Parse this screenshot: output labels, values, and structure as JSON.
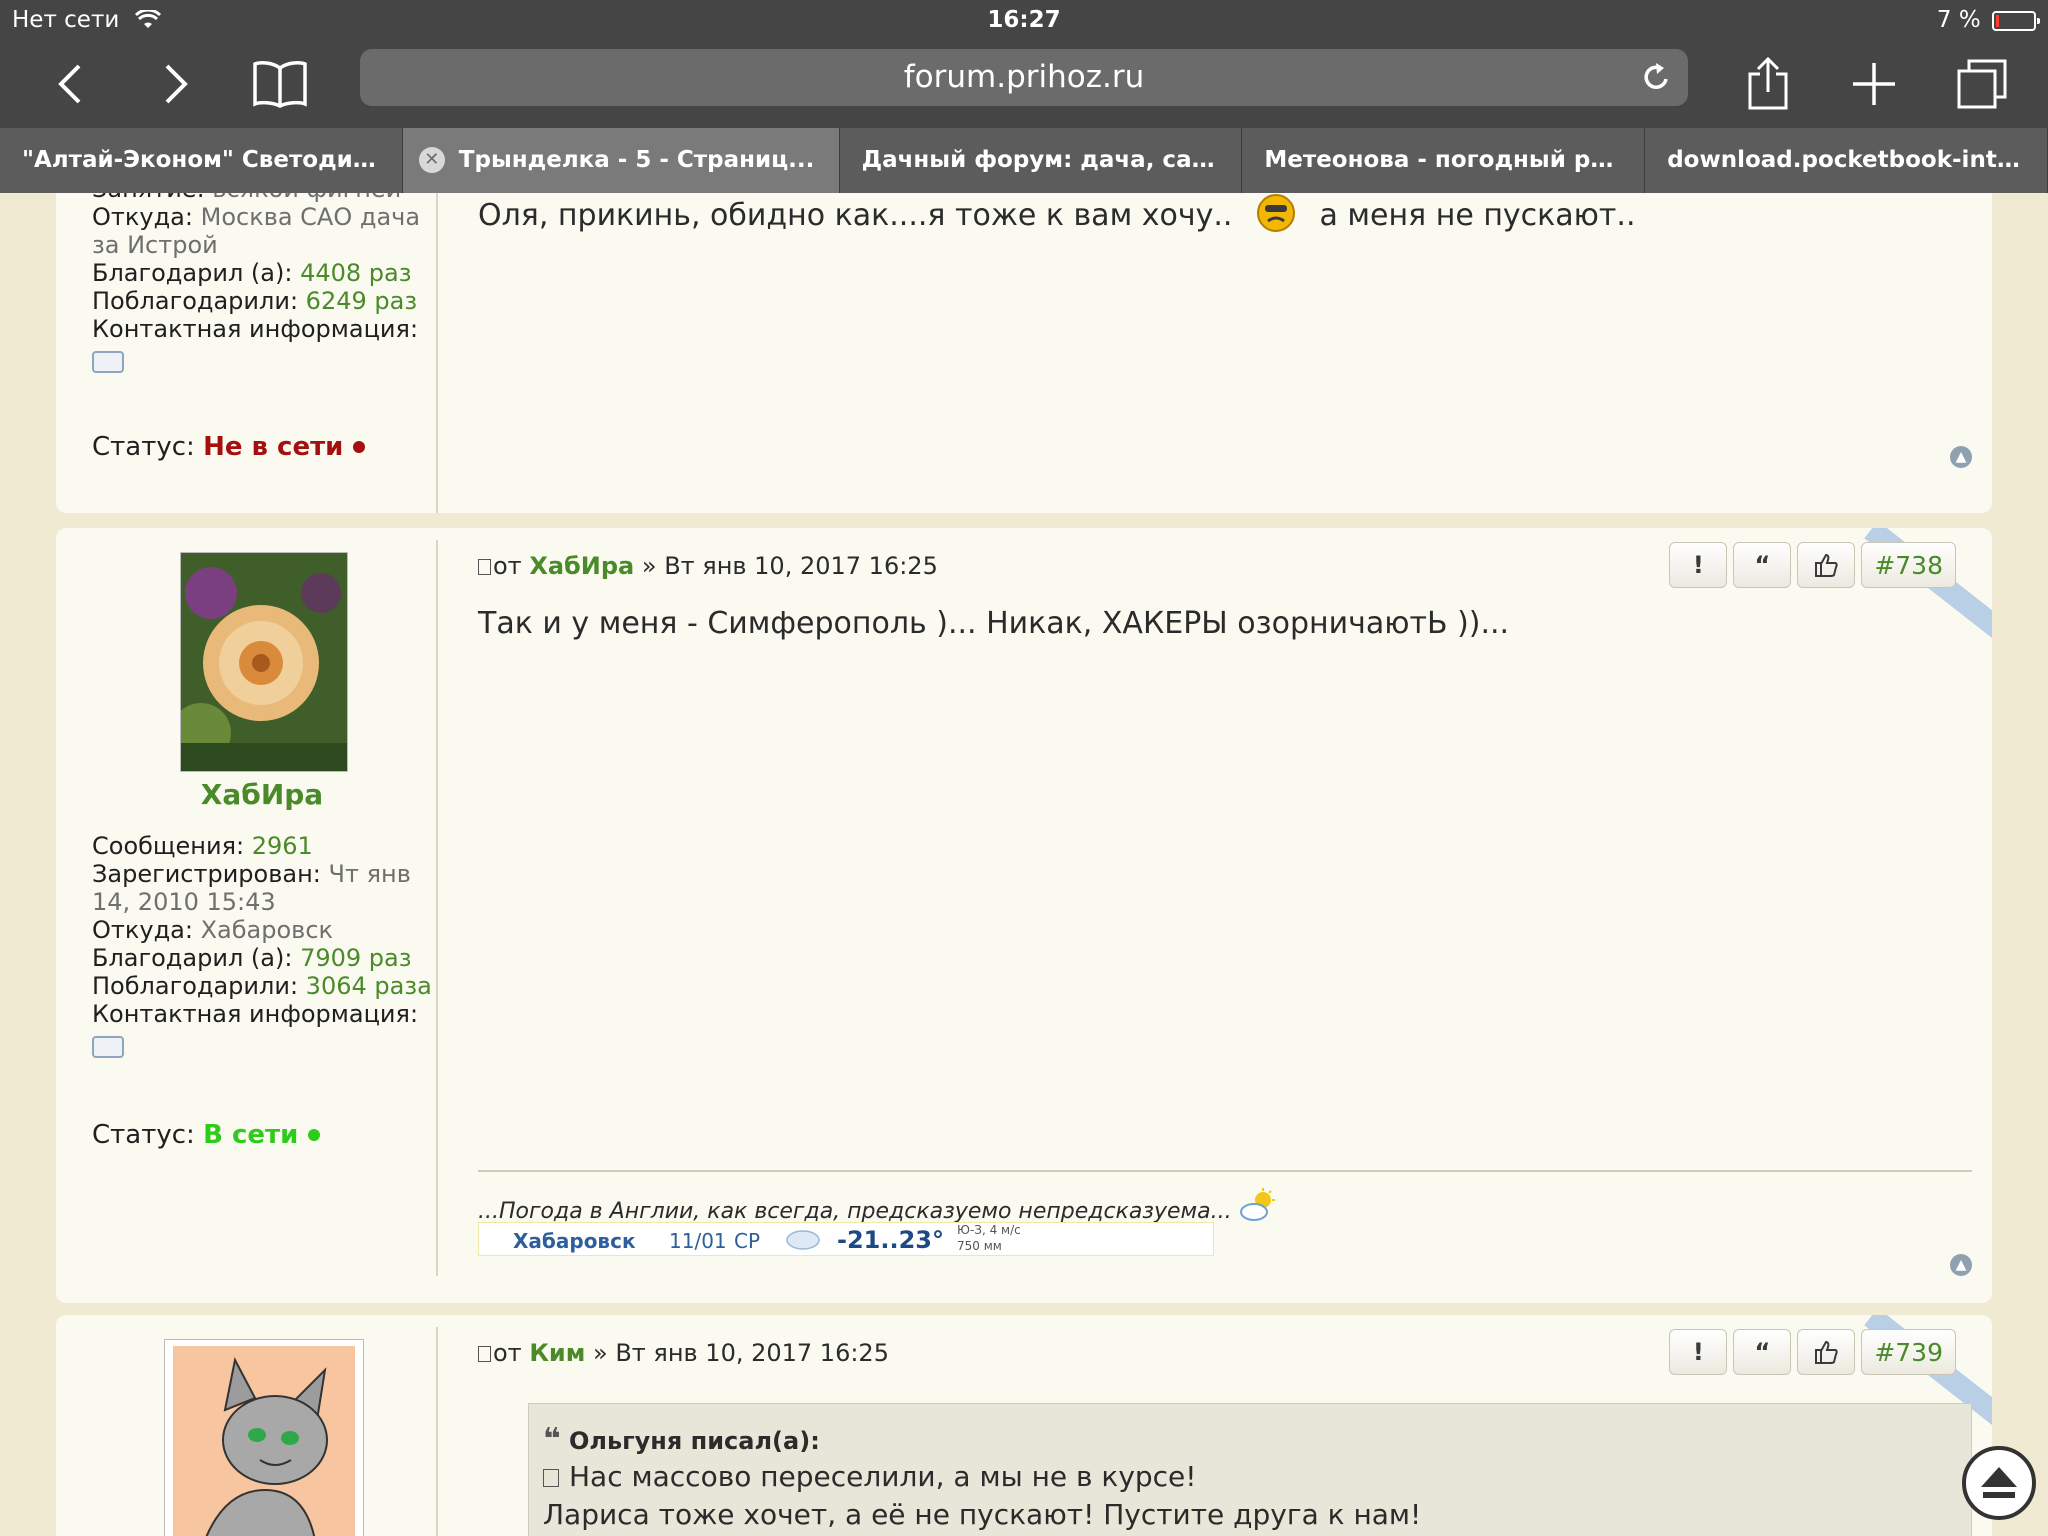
{
  "status_bar": {
    "network": "Нет сети",
    "time": "16:27",
    "battery": "7 %"
  },
  "browser": {
    "url": "forum.prihoz.ru",
    "tabs": [
      {
        "label": "\"Алтай-Эконом\" Светодиод..."
      },
      {
        "label": "Трынделка - 5 - Страниц..."
      },
      {
        "label": "Дачный форум: дача, сад,..."
      },
      {
        "label": "Метеонова - погодный роб..."
      },
      {
        "label": "download.pocketbook-int.co..."
      }
    ]
  },
  "post1": {
    "occupation_label": "Занятие:",
    "occupation_value": "всякой фигней",
    "from_label": "Откуда:",
    "from_value_1": "Москва САО дача",
    "from_value_2": "за Истрой",
    "thanked_label": "Благодарил (а):",
    "thanked_value": "4408 раз",
    "got_thanks_label": "Поблагодарили:",
    "got_thanks_value": "6249 раз",
    "contact_label": "Контактная информация:",
    "status_label": "Статус:",
    "status_value": "Не в сети",
    "text_before_smiley": "Оля, прикинь, обидно как....я тоже к вам хочу..",
    "text_after_smiley": "а меня не пускают.."
  },
  "post2": {
    "author": "ХабИра",
    "messages_label": "Сообщения:",
    "messages_value": "2961",
    "registered_label": "Зарегистрирован:",
    "registered_value_1": "Чт янв",
    "registered_value_2": "14, 2010 15:43",
    "from_label": "Откуда:",
    "from_value": "Хабаровск",
    "thanked_label": "Благодарил (а):",
    "thanked_value": "7909 раз",
    "got_thanks_label": "Поблагодарили:",
    "got_thanks_value": "3064 раза",
    "contact_label": "Контактная информация:",
    "status_label": "Статус:",
    "status_value": "В сети",
    "head_prefix": "от",
    "head_date": "» Вт янв 10, 2017 16:25",
    "post_number": "#738",
    "text": "Так и у меня - Симферополь )... Никак, ХАКЕРЫ озорничаютЬ ))...",
    "signature": "...Погода в Англии, как всегда, предсказуемо непредсказуема...",
    "weather": {
      "city": "Хабаровск",
      "date": "11/01",
      "weekday": "СР",
      "temp": "-21..23°",
      "wind": "Ю-З, 4 м/с",
      "pressure": "750 мм"
    }
  },
  "post3": {
    "author": "Ким",
    "head_prefix": "от",
    "head_date": "» Вт янв 10, 2017 16:25",
    "post_number": "#739",
    "quote_title": "Ольгуня писал(а):",
    "quote_line_1": "Нас массово переселили, а мы не в курсе!",
    "quote_line_2": "Лариса тоже хочет, а её не пускают! Пустите друга к нам!"
  },
  "buttons": {
    "report": "!",
    "quote": "“",
    "like_icon": "thumbs-up-icon"
  },
  "colors": {
    "accent_green": "#4a8a2a",
    "offline_red": "#a40f0f",
    "online_green": "#2ecc1a"
  }
}
